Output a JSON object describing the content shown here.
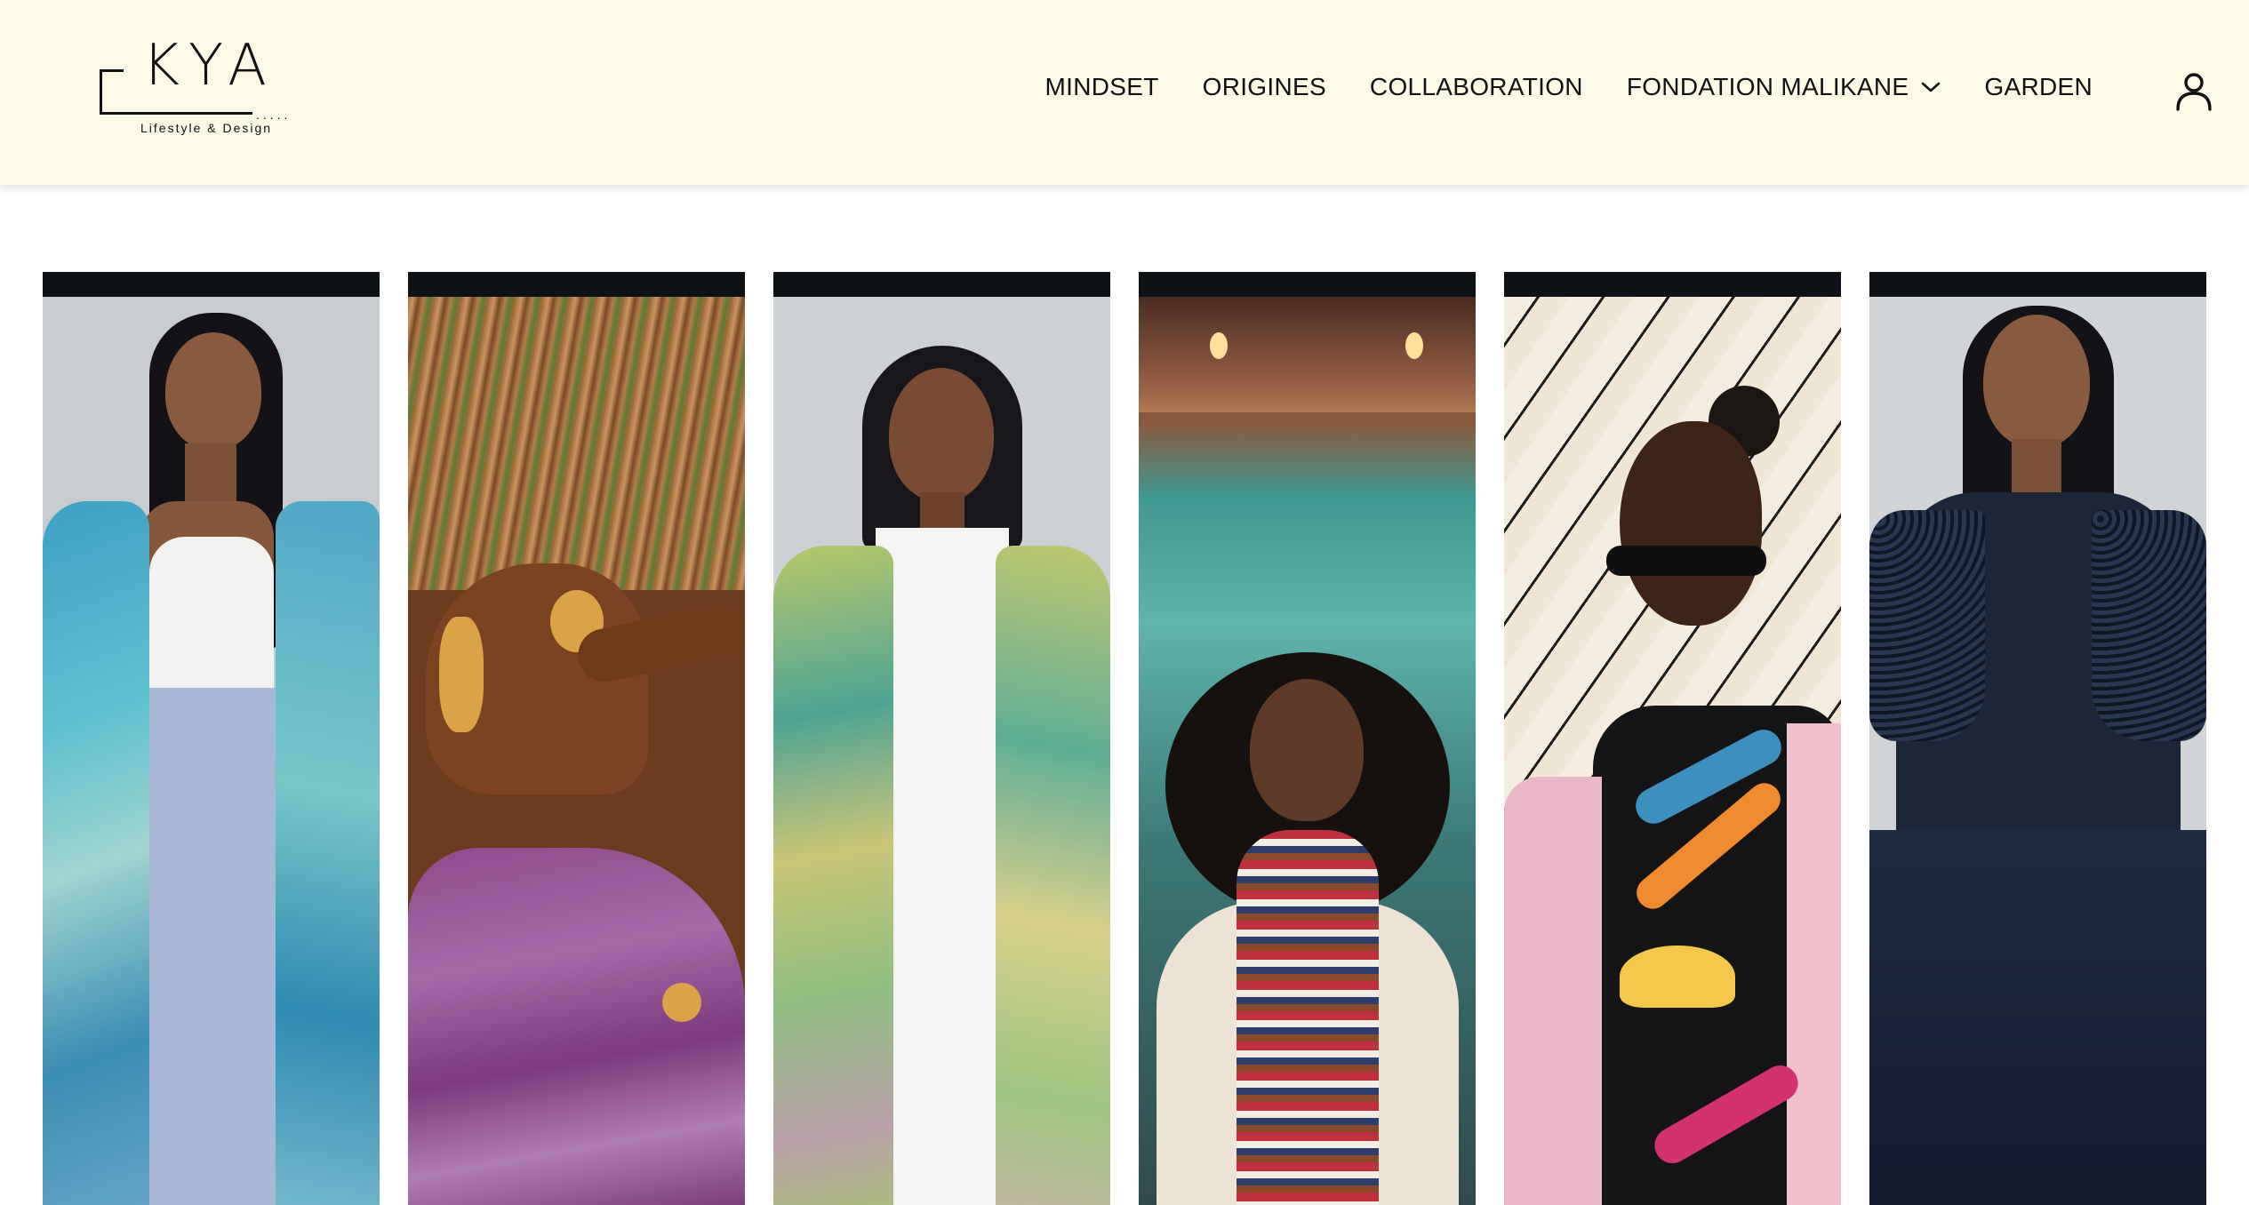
{
  "logo": {
    "letters": "KYA",
    "dots": ".....",
    "tagline": "Lifestyle & Design"
  },
  "nav": {
    "items": [
      {
        "label": "MINDSET"
      },
      {
        "label": "ORIGINES"
      },
      {
        "label": "COLLABORATION"
      },
      {
        "label": "FONDATION MALIKANE",
        "has_dropdown": true
      },
      {
        "label": "GARDEN"
      }
    ],
    "account_icon": "user-icon",
    "dropdown_icon": "chevron-down-icon"
  },
  "gallery": {
    "panels": [
      {
        "subject": "woman-blue-kimono",
        "bg": "#c7cbd0"
      },
      {
        "subject": "woman-purple-dress-gold-jewelry",
        "bg": "#8a5a36"
      },
      {
        "subject": "woman-white-shirt-green-kimono",
        "bg": "#cfd2d6"
      },
      {
        "subject": "woman-beaded-necklaces-doorway",
        "bg": "#4a7f7a"
      },
      {
        "subject": "woman-sunglasses-embroidered-jacket",
        "bg": "#efe7d6"
      },
      {
        "subject": "woman-navy-dress",
        "bg": "#cfd3d6"
      }
    ]
  },
  "colors": {
    "header_bg": "#fdf9e6",
    "panel_top_bar": "#0e1116",
    "text": "#111111"
  }
}
